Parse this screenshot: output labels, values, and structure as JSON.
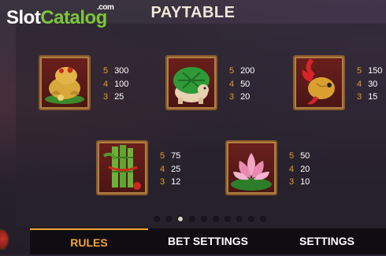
{
  "header": {
    "title": "PAYTABLE"
  },
  "watermark": {
    "brand_a": "Slot",
    "brand_b": "Catalog",
    "suffix": ".com"
  },
  "symbols": [
    {
      "icon": "golden-toad-icon",
      "pays": [
        {
          "count": "5",
          "value": "300"
        },
        {
          "count": "4",
          "value": "100"
        },
        {
          "count": "3",
          "value": "25"
        }
      ]
    },
    {
      "icon": "jade-turtle-icon",
      "pays": [
        {
          "count": "5",
          "value": "200"
        },
        {
          "count": "4",
          "value": "50"
        },
        {
          "count": "3",
          "value": "20"
        }
      ]
    },
    {
      "icon": "koi-fish-icon",
      "pays": [
        {
          "count": "5",
          "value": "150"
        },
        {
          "count": "4",
          "value": "30"
        },
        {
          "count": "3",
          "value": "15"
        }
      ]
    },
    {
      "icon": "bamboo-icon",
      "pays": [
        {
          "count": "5",
          "value": "75"
        },
        {
          "count": "4",
          "value": "25"
        },
        {
          "count": "3",
          "value": "12"
        }
      ]
    },
    {
      "icon": "lotus-flower-icon",
      "pays": [
        {
          "count": "5",
          "value": "50"
        },
        {
          "count": "4",
          "value": "20"
        },
        {
          "count": "3",
          "value": "10"
        }
      ]
    }
  ],
  "pagination": {
    "total_pages": 10,
    "current_page": 3
  },
  "tabs": [
    {
      "label": "RULES",
      "active": true
    },
    {
      "label": "BET SETTINGS",
      "active": false
    },
    {
      "label": "SETTINGS",
      "active": false
    }
  ],
  "colors": {
    "accent": "#f2a532",
    "count_color": "#e79a2a",
    "frame": "#8a5a2c",
    "watermark_green": "#7cc73a"
  }
}
